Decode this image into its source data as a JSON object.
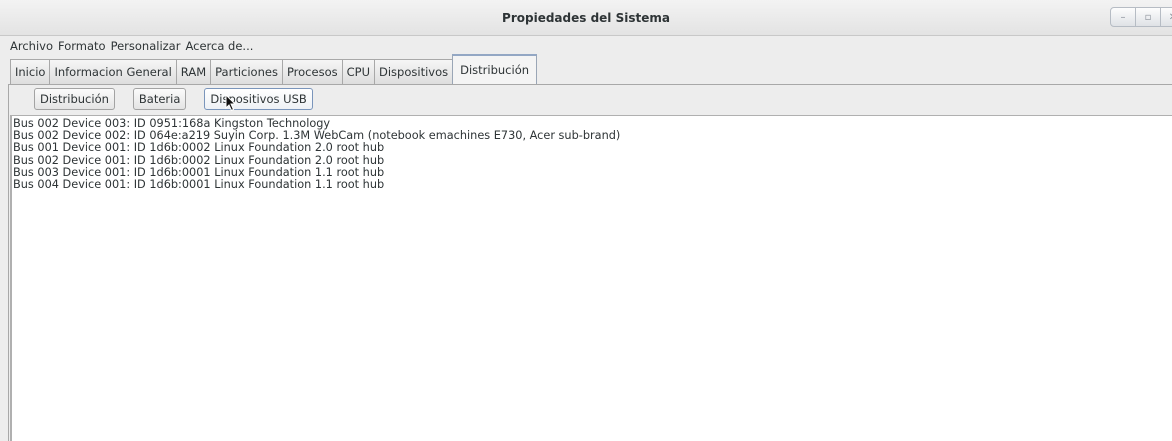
{
  "window": {
    "title": "Propiedades del Sistema"
  },
  "menubar": {
    "items": [
      "Archivo",
      "Formato",
      "Personalizar",
      "Acerca de..."
    ]
  },
  "tabs": [
    {
      "label": "Inicio"
    },
    {
      "label": "Informacion General"
    },
    {
      "label": "RAM"
    },
    {
      "label": "Particiones"
    },
    {
      "label": "Procesos"
    },
    {
      "label": "CPU"
    },
    {
      "label": "Dispositivos"
    },
    {
      "label": "Distribución",
      "active": true
    }
  ],
  "buttons": {
    "distribucion": "Distribución",
    "bateria": "Bateria",
    "usb": "Dispositivos USB"
  },
  "output": {
    "lines": [
      "Bus 002 Device 003: ID 0951:168a Kingston Technology",
      "Bus 002 Device 002: ID 064e:a219 Suyin Corp. 1.3M WebCam (notebook emachines E730, Acer sub-brand)",
      "Bus 001 Device 001: ID 1d6b:0002 Linux Foundation 2.0 root hub",
      "Bus 002 Device 001: ID 1d6b:0002 Linux Foundation 2.0 root hub",
      "Bus 003 Device 001: ID 1d6b:0001 Linux Foundation 1.1 root hub",
      "Bus 004 Device 001: ID 1d6b:0001 Linux Foundation 1.1 root hub"
    ]
  },
  "icons": {
    "minimize": "minimize-icon",
    "maximize": "maximize-icon",
    "close": "close-icon",
    "pointer": "mouse-pointer-icon"
  }
}
